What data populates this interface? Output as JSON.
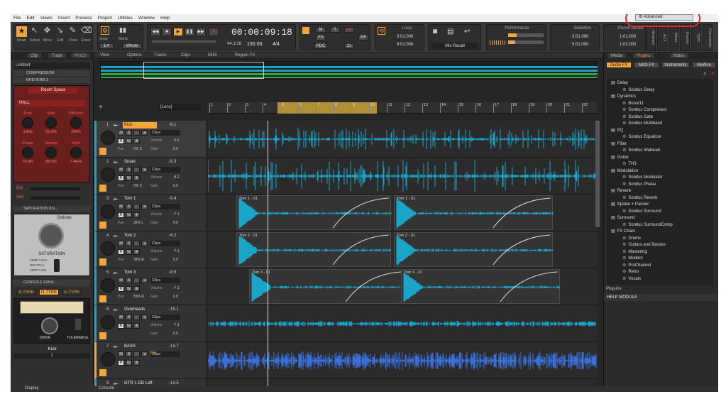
{
  "menu": [
    "File",
    "Edit",
    "Views",
    "Insert",
    "Process",
    "Project",
    "Utilities",
    "Window",
    "Help"
  ],
  "tools": [
    "Smart",
    "Select",
    "Move",
    "Edit",
    "Draw",
    "Erase"
  ],
  "snap": {
    "label": "Snap",
    "marks": "Marks",
    "whole": "Whole",
    "quant": "1/4"
  },
  "transport": {
    "time": "00:00:09:18",
    "tempo": "150.00",
    "meter": "4/4",
    "rate": "44.1",
    "bits": "16"
  },
  "mix": {
    "m": "M",
    "s": "S",
    "fx": "FX",
    "pdc": "PDC",
    "rate": "2x"
  },
  "loop": {
    "label": "Loop",
    "start": "3:01:000",
    "end": "9:01:000"
  },
  "mixrecall": "Mix Recall",
  "perf": {
    "label": "Performance"
  },
  "sel": {
    "label": "Selection",
    "start": "3:01:000",
    "end": "5:01:000"
  },
  "punch": {
    "label": "Punch In/Out",
    "start": "1:01:000",
    "end": "1:01:000"
  },
  "workspace": "Advanced",
  "sidetabs": [
    "Browser",
    "ACT",
    "Mixer",
    "Events",
    "Sync",
    "Comments"
  ],
  "intabs": [
    "Clip",
    "Track",
    "ProCh"
  ],
  "insp": {
    "preset": "Untitled",
    "fx1": "COMPRESSOR",
    "fx2": "BREVERB 2",
    "room": "Room Space",
    "hall": "HALL",
    "knobs1": [
      "Time",
      "Size",
      "Diffusion"
    ],
    "vals1": [
      "3.80s",
      "63.5%",
      "100%"
    ],
    "knobs2": [
      "Shape",
      "Spread",
      "High"
    ],
    "vals2": [
      "74.8%",
      "88.5%",
      "7.4kHz"
    ],
    "dry": "Dry",
    "wet": "Wet",
    "sat": "SATURATION KN...",
    "softube": "Softube",
    "satname": "SATURATION",
    "sat_opts": [
      "KEEP HIGH",
      "NEUTRAL",
      "KEEP LOW"
    ],
    "console": "CONSOLE EMUL...",
    "types": [
      "S-TYPE",
      "N-TYPE",
      "A-TYPE"
    ],
    "drive": "DRIVE",
    "tol": "TOLERANCE",
    "track": "Kick",
    "num": "1",
    "display": "Display"
  },
  "viewtabs": [
    "View",
    "Options",
    "Tracks",
    "Clips",
    "MIDI",
    "Region FX"
  ],
  "lens": "[Lens]",
  "ruler": [
    "1",
    "2",
    "3",
    "4",
    "5",
    "6",
    "7",
    "8",
    "9",
    "10",
    "11",
    "12",
    "13",
    "14",
    "15",
    "16",
    "17",
    "18",
    "19",
    "20",
    "21",
    "22"
  ],
  "tracks": [
    {
      "num": "1",
      "name": "Kick",
      "vol": "-6.1",
      "mode": "Clips",
      "gain": "0.0",
      "pan": "0% C",
      "volv": "-5.6",
      "sel": true
    },
    {
      "num": "2",
      "name": "Snare",
      "vol": "-8.3",
      "mode": "Clips",
      "gain": "0.0",
      "pan": "0% C",
      "volv": "-8.2"
    },
    {
      "num": "3",
      "name": "Tom 1",
      "vol": "-9.4",
      "mode": "Clips",
      "gain": "0.0",
      "pan": "35% L",
      "volv": "-7.1"
    },
    {
      "num": "4",
      "name": "Tom 2",
      "vol": "-6.2",
      "mode": "Clips",
      "gain": "0.0",
      "pan": "38% R",
      "volv": "-7.1"
    },
    {
      "num": "5",
      "name": "Tom 3",
      "vol": "-8.5",
      "mode": "Clips",
      "gain": "0.0",
      "pan": "55% R",
      "volv": "-7.1"
    },
    {
      "num": "6",
      "name": "Overheads",
      "vol": "-15.1",
      "mode": "Clips",
      "gain": "0.0",
      "pan": "",
      "volv": "-7.1"
    },
    {
      "num": "7",
      "name": "BASS",
      "vol": "-14.7",
      "mode": "Clips",
      "gain": "",
      "pan": "",
      "volv": ""
    },
    {
      "num": "8",
      "name": "GTR 1 DD Left",
      "vol": "-14.5",
      "mode": "",
      "gain": "",
      "pan": "",
      "volv": ""
    }
  ],
  "labels": {
    "pan": "Pan",
    "gain": "Gain",
    "volume": "Volume",
    "fx": "FX"
  },
  "clips": {
    "tom1a": "Tom 1 - 01",
    "tom1b": "Tom 1 - 01",
    "tom2a": "Tom 2 - 01",
    "tom2b": "Tom 2 - 01",
    "tom3a": "Tom 3 - 01",
    "tom3b": "Tom 3 - 01"
  },
  "btabs": [
    "Media",
    "Plugins",
    "Notes"
  ],
  "bsub": [
    "Audio FX",
    "MIDI FX",
    "Instruments",
    "ReWire"
  ],
  "tree": [
    {
      "t": "Delay",
      "l": 0
    },
    {
      "t": "Sonitus Delay",
      "l": 1
    },
    {
      "t": "Dynamics",
      "l": 0
    },
    {
      "t": "Boost11",
      "l": 1
    },
    {
      "t": "Sonitus Compressor",
      "l": 1
    },
    {
      "t": "Sonitus Gate",
      "l": 1
    },
    {
      "t": "Sonitus Multiband",
      "l": 1
    },
    {
      "t": "EQ",
      "l": 0
    },
    {
      "t": "Sonitus Equalizer",
      "l": 1
    },
    {
      "t": "Filter",
      "l": 0
    },
    {
      "t": "Sonitus Wahwah",
      "l": 1
    },
    {
      "t": "Guitar",
      "l": 0
    },
    {
      "t": "TH3",
      "l": 1
    },
    {
      "t": "Modulation",
      "l": 0
    },
    {
      "t": "Sonitus Modulator",
      "l": 1
    },
    {
      "t": "Sonitus Phase",
      "l": 1
    },
    {
      "t": "Reverb",
      "l": 0
    },
    {
      "t": "Sonitus Reverb",
      "l": 1
    },
    {
      "t": "Spatial + Panner",
      "l": 0
    },
    {
      "t": "Sonitus Surround",
      "l": 1
    },
    {
      "t": "Surround",
      "l": 0
    },
    {
      "t": "Sonitus SurroundComp",
      "l": 1
    },
    {
      "t": "FX Chain",
      "l": 0
    },
    {
      "t": "Drums",
      "l": 1
    },
    {
      "t": "Guitars and Basses",
      "l": 1
    },
    {
      "t": "Mastering",
      "l": 1
    },
    {
      "t": "Modern",
      "l": 1
    },
    {
      "t": "ProChannel",
      "l": 1
    },
    {
      "t": "Retro",
      "l": 1
    },
    {
      "t": "Vocals",
      "l": 1
    }
  ],
  "plugin_in": "Plug-ins",
  "help": "HELP MODULE",
  "console_tab": "Console",
  "colors": {
    "accent": "#f08a3c",
    "wave": "#1aa4c8",
    "bass": "#3a6fd8",
    "highlight": "#e2262e"
  }
}
